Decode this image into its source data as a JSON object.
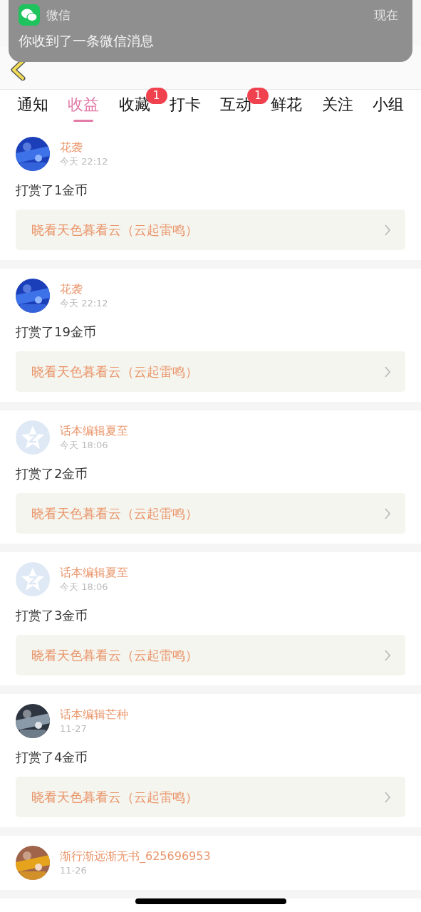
{
  "notification": {
    "app": "微信",
    "time": "现在",
    "message": "你收到了一条微信消息"
  },
  "tabs": [
    {
      "label": "通知",
      "selected": false
    },
    {
      "label": "收益",
      "selected": true
    },
    {
      "label": "收藏",
      "selected": false,
      "badge": "1"
    },
    {
      "label": "打卡",
      "selected": false
    },
    {
      "label": "互动",
      "selected": false,
      "badge": "1"
    },
    {
      "label": "鲜花",
      "selected": false
    },
    {
      "label": "关注",
      "selected": false
    },
    {
      "label": "小组",
      "selected": false
    }
  ],
  "messages": [
    {
      "name": "花袭",
      "time": "今天 22:12",
      "text": "打赏了1金币",
      "book": "晓看天色暮看云（云起雷鸣）"
    },
    {
      "name": "花袭",
      "time": "今天 22:12",
      "text": "打赏了19金币",
      "book": "晓看天色暮看云（云起雷鸣）"
    },
    {
      "avatar": {
        "kind": "default"
      },
      "name": "话本编辑夏至",
      "time": "今天 18:06",
      "text": "打赏了2金币",
      "book": "晓看天色暮看云（云起雷鸣）"
    },
    {
      "avatar": {
        "kind": "default"
      },
      "name": "话本编辑夏至",
      "time": "今天 18:06",
      "text": "打赏了3金币",
      "book": "晓看天色暮看云（云起雷鸣）"
    },
    {
      "name": "话本编辑芒种",
      "time": "11-27",
      "text": "打赏了4金币",
      "book": "晓看天色暮看云（云起雷鸣）"
    },
    {
      "name": "渐行渐远渐无书_625696953",
      "time": "11-26"
    }
  ]
}
